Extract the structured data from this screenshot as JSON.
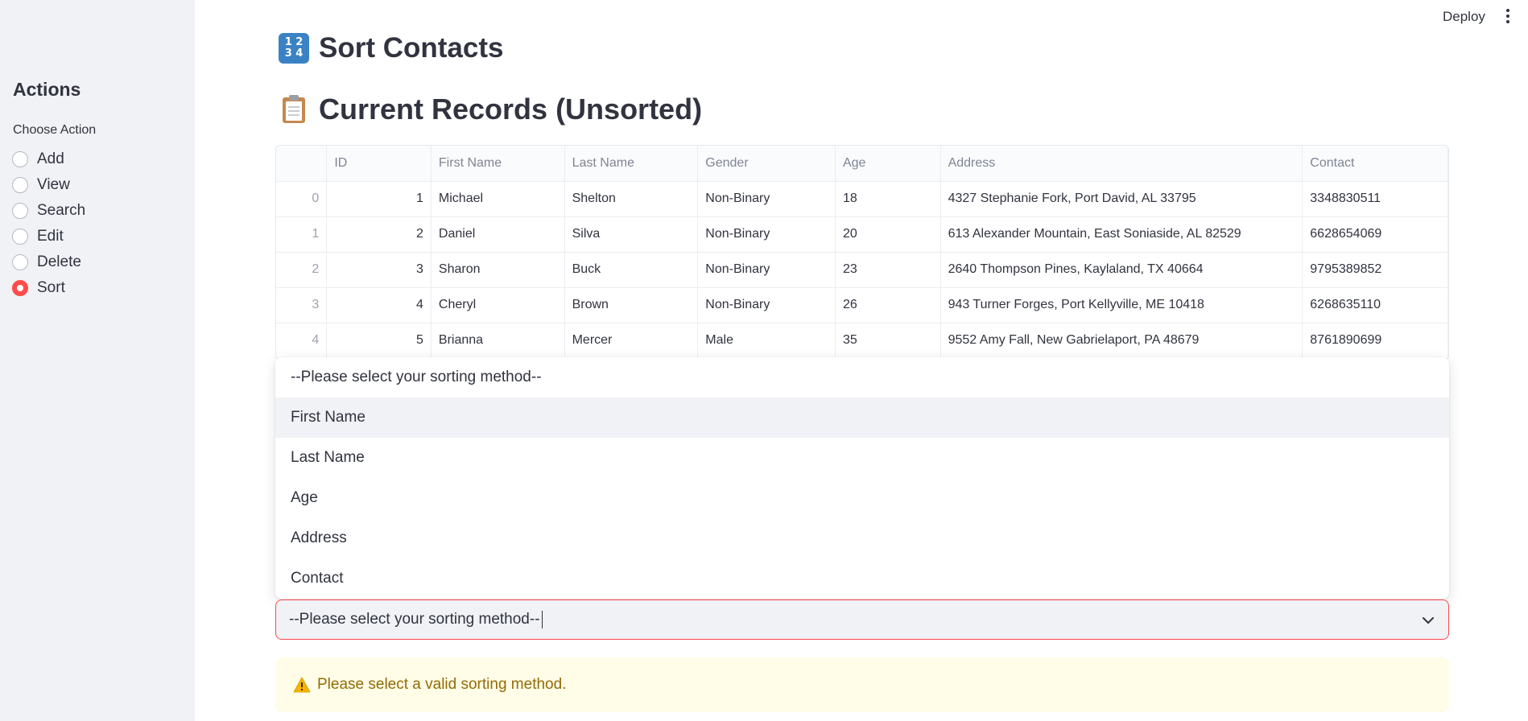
{
  "header": {
    "deploy_label": "Deploy",
    "menu_icon": "more-vertical-icon"
  },
  "sidebar": {
    "title": "Actions",
    "choose_label": "Choose Action",
    "selected": "Sort",
    "options": [
      {
        "label": "Add"
      },
      {
        "label": "View"
      },
      {
        "label": "Search"
      },
      {
        "label": "Edit"
      },
      {
        "label": "Delete"
      },
      {
        "label": "Sort"
      }
    ]
  },
  "main": {
    "title": "Sort Contacts",
    "title_icon": "input-numbers-icon",
    "records_heading": "Current Records (Unsorted)",
    "records_icon": "clipboard-icon"
  },
  "table": {
    "columns": [
      "",
      "ID",
      "First Name",
      "Last Name",
      "Gender",
      "Age",
      "Address",
      "Contact"
    ],
    "rows": [
      [
        "0",
        "1",
        "Michael",
        "Shelton",
        "Non-Binary",
        "18",
        "4327 Stephanie Fork, Port David, AL 33795",
        "3348830511"
      ],
      [
        "1",
        "2",
        "Daniel",
        "Silva",
        "Non-Binary",
        "20",
        "613 Alexander Mountain, East Soniaside, AL 82529",
        "6628654069"
      ],
      [
        "2",
        "3",
        "Sharon",
        "Buck",
        "Non-Binary",
        "23",
        "2640 Thompson Pines, Kaylaland, TX 40664",
        "9795389852"
      ],
      [
        "3",
        "4",
        "Cheryl",
        "Brown",
        "Non-Binary",
        "26",
        "943 Turner Forges, Port Kellyville, ME 10418",
        "6268635110"
      ],
      [
        "4",
        "5",
        "Brianna",
        "Mercer",
        "Male",
        "35",
        "9552 Amy Fall, New Gabrielaport, PA 48679",
        "8761890699"
      ]
    ]
  },
  "sort_select": {
    "value": "--Please select your sorting method--",
    "options": [
      "--Please select your sorting method--",
      "First Name",
      "Last Name",
      "Age",
      "Address",
      "Contact"
    ],
    "highlighted": "First Name"
  },
  "warning": {
    "icon": "warning-icon",
    "text": "Please select a valid sorting method."
  },
  "colors": {
    "accent": "#ff4b4b",
    "sidebar_bg": "#f0f2f6",
    "warning_bg": "#fffce7",
    "warning_text": "#926c05"
  }
}
